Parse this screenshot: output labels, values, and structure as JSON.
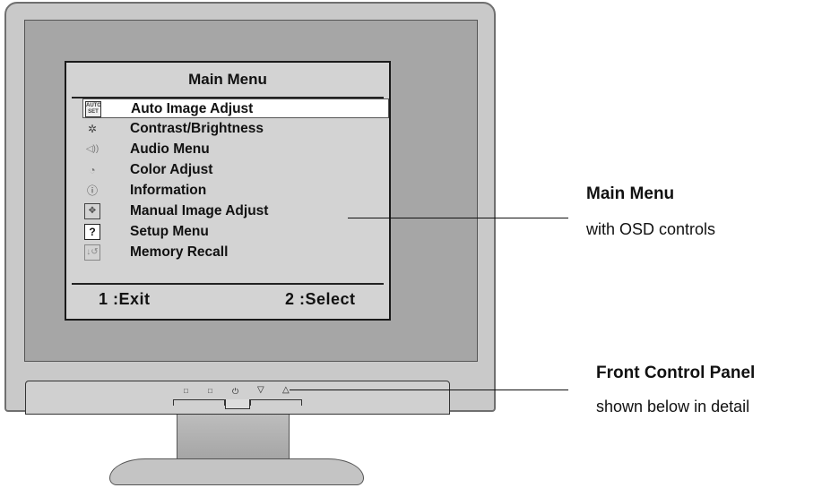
{
  "osd": {
    "title": "Main Menu",
    "items": [
      {
        "label": "Auto Image Adjust",
        "icon": "auto-set-icon",
        "icon_text": "AUTO SET",
        "selected": true
      },
      {
        "label": "Contrast/Brightness",
        "icon": "brightness-icon"
      },
      {
        "label": "Audio Menu",
        "icon": "speaker-icon"
      },
      {
        "label": "Color Adjust",
        "icon": "color-palette-icon"
      },
      {
        "label": "Information",
        "icon": "info-icon"
      },
      {
        "label": "Manual Image Adjust",
        "icon": "four-arrows-icon"
      },
      {
        "label": "Setup Menu",
        "icon": "question-icon",
        "icon_text": "?"
      },
      {
        "label": "Memory Recall",
        "icon": "recall-icon"
      }
    ],
    "footer": {
      "exit": "1 :Exit",
      "select": "2 :Select"
    }
  },
  "callouts": {
    "main_menu": {
      "title": "Main Menu",
      "subtitle": "with OSD controls"
    },
    "front_panel": {
      "title": "Front Control Panel",
      "subtitle": "shown below in detail"
    }
  },
  "colors": {
    "bezel": "#c9c9c9",
    "screen": "#a6a6a6",
    "osd": "#d3d3d3",
    "highlight": "#ffffff"
  }
}
